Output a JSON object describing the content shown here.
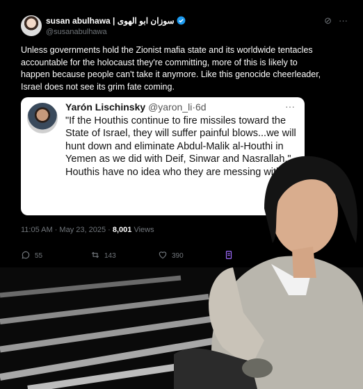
{
  "tweet": {
    "author_name": "susan abulhawa | سوزان ابو الهوى",
    "author_handle": "@susanabulhawa",
    "text": "Unless governments hold the Zionist mafia state and its worldwide tentacles accountable for the holocaust they're committing, more of this is likely to happen because people can't take it anymore. Like this genocide cheerleader, Israel does not see its grim fate coming.",
    "timestamp": "11:05 AM · May 23, 2025 · ",
    "views_count": "8,001",
    "views_label": " Views",
    "replies": "55",
    "reposts": "143",
    "likes": "390"
  },
  "quote": {
    "author_name": "Yarón Lischinsky",
    "author_handle": "@yaron_li",
    "age": "6d",
    "more": "···",
    "text_1": "\"If the Houthis continue to fire missiles toward the State of Israel, they will suffer painful blows...we will hunt down and eliminate Abdul-Malik al-Houthi in Yemen as we did with Deif, Sinwar and Nasrallah.\"",
    "text_2": "Houthis have no idea who they are messing with."
  },
  "icons": {
    "verified": "verified-badge-icon",
    "grok": "grok-icon",
    "more": "more-icon",
    "reply": "reply-icon",
    "repost": "repost-icon",
    "like": "like-icon",
    "bookmark": "bookmark-icon"
  },
  "colors": {
    "verified": "#1d9bf0",
    "accent": "#a06cff",
    "muted": "#71767b"
  }
}
